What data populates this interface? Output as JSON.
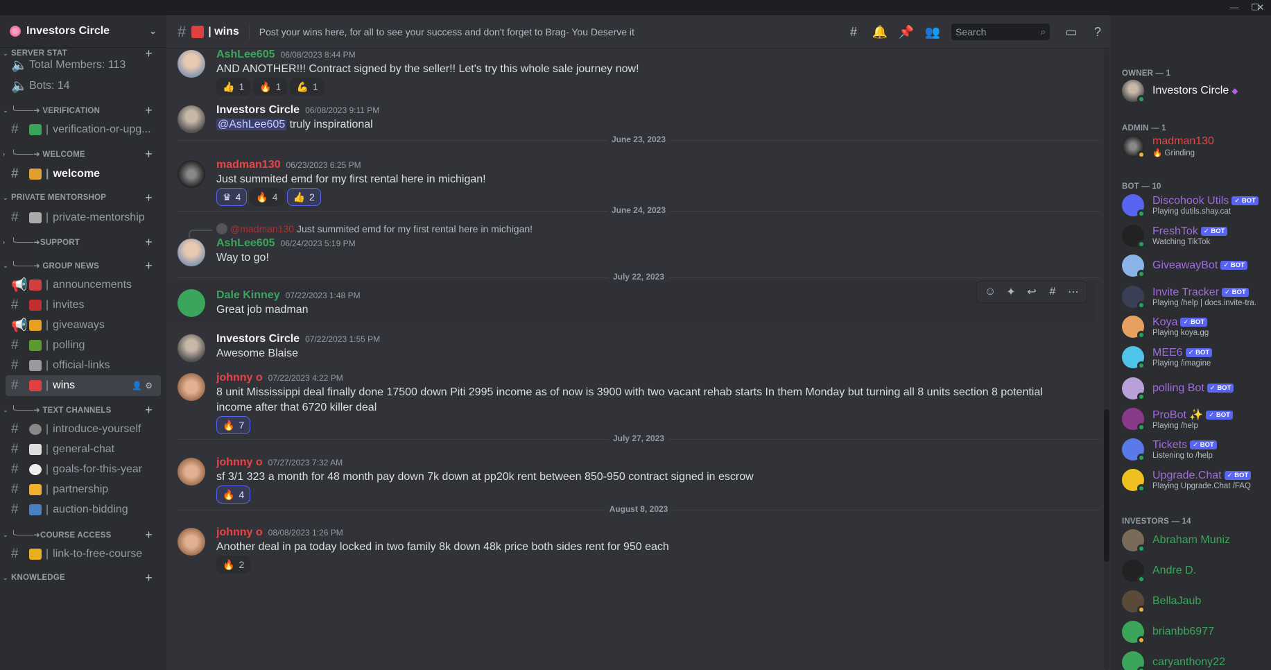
{
  "window": {
    "minimize": "—",
    "maximize": "☐",
    "close": "✕"
  },
  "server": {
    "name": "Investors Circle"
  },
  "sidebar": {
    "categories": {
      "server_stat": "SERVER STAT",
      "verification": "╰───➜ VERIFICATION",
      "welcome": "╰───➜ WELCOME",
      "private_mentorship": "PRIVATE MENTORSHOP",
      "support": "╰───➜SUPPORT",
      "group_news": "╰───➜ GROUP NEWS",
      "text_channels": "╰───➜ TEXT CHANNELS",
      "course_access": "╰───➜COURSE ACCESS",
      "knowledge": "KNOWLEDGE"
    },
    "channels": {
      "total_members": "Total Members: 113",
      "bots": "Bots: 14",
      "verification": "verification-or-upg...",
      "welcome": "welcome",
      "private_mentorship": "private-mentorship",
      "announcements": "announcements",
      "invites": "invites",
      "giveaways": "giveaways",
      "polling": "polling",
      "official_links": "official-links",
      "wins": "wins",
      "introduce_yourself": "introduce-yourself",
      "general_chat": "general-chat",
      "goals": "goals-for-this-year",
      "partnership": "partnership",
      "auction": "auction-bidding",
      "link_course": "link-to-free-course"
    }
  },
  "header": {
    "channel": "wins",
    "topic": "Post your wins here, for all to see your success and don't forget to Brag- You Deserve it",
    "search_placeholder": "Search"
  },
  "messages": {
    "m1": {
      "author": "AshLee605",
      "time": "06/08/2023 8:44 PM",
      "text": "AND ANOTHER!!! Contract signed by the seller!! Let's try this whole sale journey now!",
      "r1": "1",
      "r2": "1",
      "r3": "1"
    },
    "m2": {
      "author": "Investors Circle",
      "time": "06/08/2023 9:11 PM",
      "mention": "@AshLee605",
      "text": " truly inspirational"
    },
    "d1": "June 23, 2023",
    "m3": {
      "author": "madman130",
      "time": "06/23/2023 6:25 PM",
      "text": "Just summited emd for my first rental here in michigan!",
      "r1": "4",
      "r2": "4",
      "r3": "2"
    },
    "d2": "June 24, 2023",
    "m4": {
      "reply_name": "@madman130",
      "reply_text": "Just summited emd for my first rental here in michigan!",
      "author": "AshLee605",
      "time": "06/24/2023 5:19 PM",
      "text": "Way to go!"
    },
    "d3": "July 22, 2023",
    "m5": {
      "author": "Dale Kinney",
      "time": "07/22/2023 1:48 PM",
      "text": "Great job madman"
    },
    "m6": {
      "author": "Investors Circle",
      "time": "07/22/2023 1:55 PM",
      "text": "Awesome Blaise"
    },
    "m7": {
      "author": "johnny o",
      "time": "07/22/2023 4:22 PM",
      "text": "8 unit Mississippi deal finally done 17500 down Piti 2995 income as of now is 3900 with two vacant rehab starts In them Monday but turning all 8 units section 8 potential income after that 6720 killer deal",
      "r1": "7"
    },
    "d4": "July 27, 2023",
    "m8": {
      "author": "johnny o",
      "time": "07/27/2023 7:32 AM",
      "text": "sf 3/1 323 a month for 48 month pay down 7k down at pp20k rent between 850-950 contract signed in escrow",
      "r1": "4"
    },
    "d5": "August 8, 2023",
    "m9": {
      "author": "johnny o",
      "time": "08/08/2023 1:26 PM",
      "text": "Another deal in pa today locked in two family 8k down 48k price both sides rent for 950 each",
      "r1": "2"
    }
  },
  "members": {
    "owner_header": "OWNER — 1",
    "owner": {
      "name": "Investors Circle"
    },
    "admin_header": "ADMIN — 1",
    "admin": {
      "name": "madman130",
      "status": "Grinding"
    },
    "bot_header": "BOT — 10",
    "bots": [
      {
        "name": "Discohook Utils",
        "status": "Playing dutils.shay.cat",
        "badge": "✓ BOT"
      },
      {
        "name": "FreshTok",
        "status": "Watching TikTok",
        "badge": "✓ BOT"
      },
      {
        "name": "GiveawayBot",
        "status": "",
        "badge": "✓ BOT"
      },
      {
        "name": "Invite Tracker",
        "status": "Playing /help | docs.invite-tra...",
        "badge": "✓ BOT"
      },
      {
        "name": "Koya",
        "status": "Playing koya.gg",
        "badge": "✓ BOT"
      },
      {
        "name": "MEE6",
        "status": "Playing /imagine",
        "badge": "✓ BOT"
      },
      {
        "name": "polling Bot",
        "status": "",
        "badge": "✓ BOT"
      },
      {
        "name": "ProBot ✨",
        "status": "Playing /help",
        "badge": "✓ BOT"
      },
      {
        "name": "Tickets",
        "status": "Listening to /help",
        "badge": "✓ BOT"
      },
      {
        "name": "Upgrade.Chat",
        "status": "Playing Upgrade.Chat /FAQ",
        "badge": "✓ BOT"
      }
    ],
    "investors_header": "INVESTORS — 14",
    "investors": [
      {
        "name": "Abraham Muniz"
      },
      {
        "name": "Andre D."
      },
      {
        "name": "BellaJaub"
      },
      {
        "name": "brianbb6977"
      },
      {
        "name": "caryanthony22"
      }
    ]
  },
  "colors": {
    "green_name": "#3ba55c",
    "red_name": "#ed4245",
    "bot_purple": "#a16be0",
    "blurple": "#5865f2"
  }
}
